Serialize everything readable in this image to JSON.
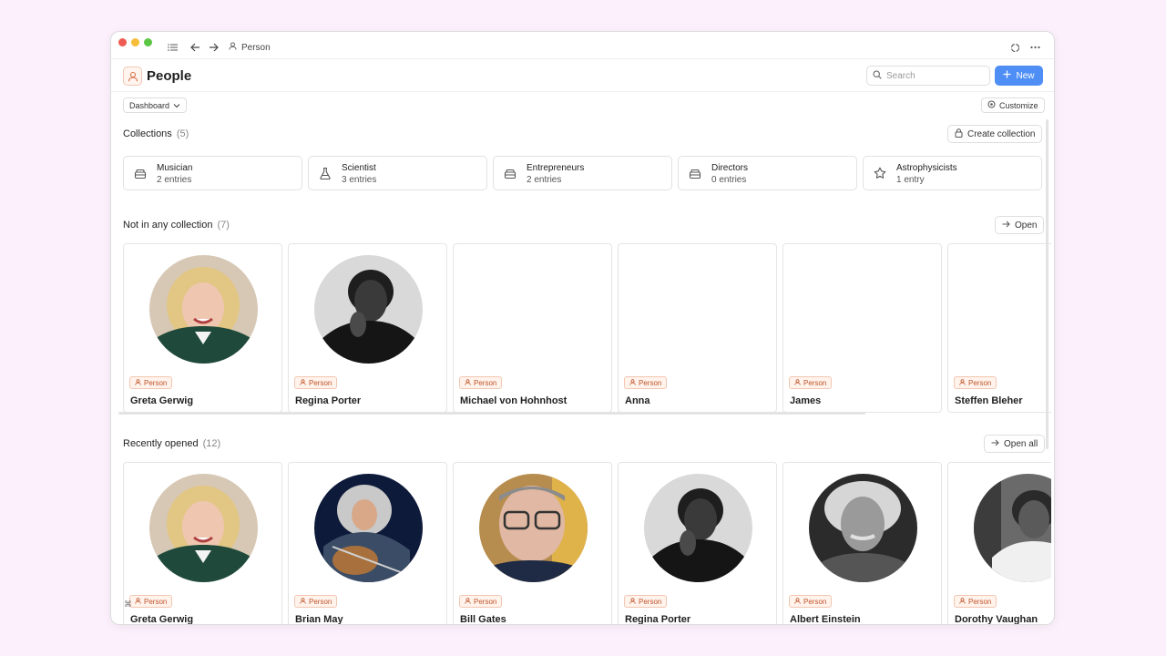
{
  "titlebar": {
    "breadcrumb": "Person"
  },
  "header": {
    "title": "People",
    "search_placeholder": "Search",
    "new_label": "New"
  },
  "toolbar": {
    "view_label": "Dashboard",
    "customize_label": "Customize"
  },
  "collections": {
    "title": "Collections",
    "count": "(5)",
    "create_label": "Create collection",
    "items": [
      {
        "name": "Musician",
        "entries": "2 entries",
        "icon": "stack-icon"
      },
      {
        "name": "Scientist",
        "entries": "3 entries",
        "icon": "flask-icon"
      },
      {
        "name": "Entrepreneurs",
        "entries": "2 entries",
        "icon": "stack-icon"
      },
      {
        "name": "Directors",
        "entries": "0 entries",
        "icon": "stack-icon"
      },
      {
        "name": "Astrophysicists",
        "entries": "1 entry",
        "icon": "star-icon"
      }
    ]
  },
  "not_in_collection": {
    "title": "Not in any collection",
    "count": "(7)",
    "open_label": "Open",
    "badge": "Person",
    "people": [
      {
        "name": "Greta Gerwig"
      },
      {
        "name": "Regina Porter"
      },
      {
        "name": "Michael von Hohnhost"
      },
      {
        "name": "Anna"
      },
      {
        "name": "James"
      },
      {
        "name": "Steffen Bleher"
      }
    ]
  },
  "recently_opened": {
    "title": "Recently opened",
    "count": "(12)",
    "open_all_label": "Open all",
    "badge": "Person",
    "people": [
      {
        "name": "Greta Gerwig"
      },
      {
        "name": "Brian May"
      },
      {
        "name": "Bill Gates"
      },
      {
        "name": "Regina Porter"
      },
      {
        "name": "Albert Einstein"
      },
      {
        "name": "Dorothy Vaughan"
      }
    ]
  },
  "colors": {
    "accent": "#4f8ff5",
    "badge_text": "#c0532a",
    "badge_bg": "#fff3ec",
    "background": "#fbf0fb"
  }
}
